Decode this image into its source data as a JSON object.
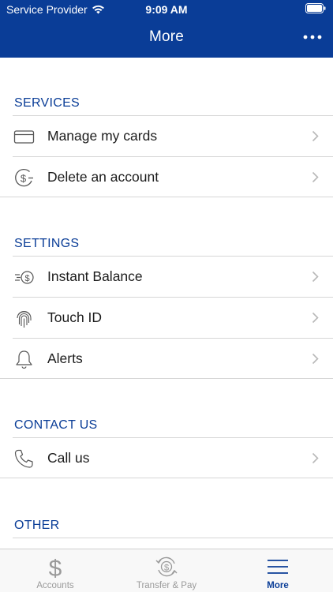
{
  "status_bar": {
    "carrier": "Service Provider",
    "time": "9:09 AM"
  },
  "header": {
    "title": "More",
    "menu_icon": "more-horizontal-icon"
  },
  "sections": {
    "services": {
      "title": "SERVICES",
      "items": [
        {
          "label": "Manage my cards",
          "icon": "card-icon"
        },
        {
          "label": "Delete an account",
          "icon": "dollar-circle-minus-icon"
        }
      ]
    },
    "settings": {
      "title": "SETTINGS",
      "items": [
        {
          "label": "Instant Balance",
          "icon": "fast-dollar-icon"
        },
        {
          "label": "Touch ID",
          "icon": "fingerprint-icon"
        },
        {
          "label": "Alerts",
          "icon": "bell-icon"
        }
      ]
    },
    "contact": {
      "title": "CONTACT US",
      "items": [
        {
          "label": "Call us",
          "icon": "phone-icon"
        }
      ]
    },
    "other": {
      "title": "OTHER"
    }
  },
  "tabbar": {
    "tabs": [
      {
        "label": "Accounts",
        "icon": "dollar-icon"
      },
      {
        "label": "Transfer & Pay",
        "icon": "transfer-icon"
      },
      {
        "label": "More",
        "icon": "menu-icon"
      }
    ],
    "active_index": 2
  },
  "colors": {
    "brand": "#0a3d97",
    "divider": "#d6d6d6",
    "inactive_tab": "#9a9a9a"
  }
}
